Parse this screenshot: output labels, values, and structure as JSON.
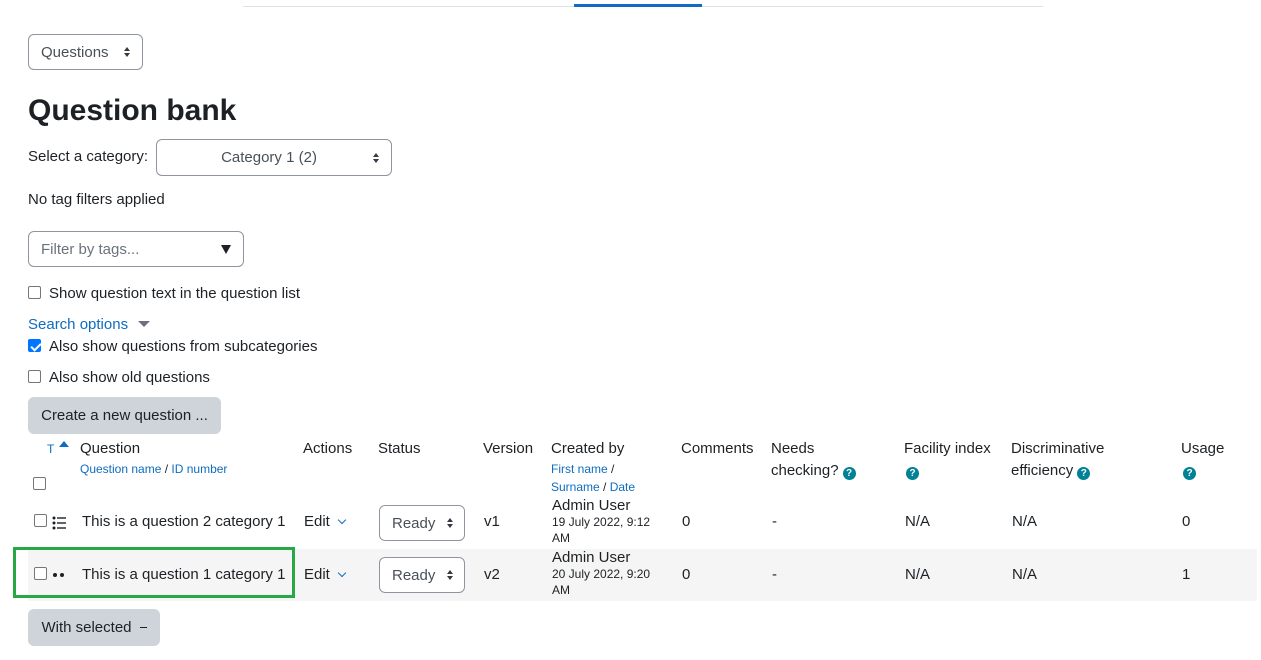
{
  "top_select": {
    "value": "Questions"
  },
  "page_title": "Question bank",
  "category": {
    "label": "Select a category:",
    "value": "Category 1 (2)"
  },
  "tags": {
    "status": "No tag filters applied",
    "placeholder": "Filter by tags..."
  },
  "options": {
    "show_text": "Show question text in the question list",
    "search_options": "Search options",
    "subcategories": "Also show questions from subcategories",
    "old_questions": "Also show old questions"
  },
  "create_button": "Create a new question ...",
  "table": {
    "sort_label": "T",
    "headers": {
      "question": "Question",
      "question_name": "Question name",
      "sep1": " / ",
      "id_number": "ID number",
      "actions": "Actions",
      "status": "Status",
      "version": "Version",
      "created_by": "Created by",
      "first_name": "First name",
      "sep2": " /",
      "surname": "Surname",
      "sep3": " / ",
      "date": "Date",
      "comments": "Comments",
      "needs1": "Needs",
      "needs2": "checking?",
      "facility": "Facility index",
      "disc1": "Discriminative",
      "disc2": "efficiency",
      "usage": "Usage",
      "help_icon": "?"
    },
    "rows": [
      {
        "question": "This is a question 2 category 1",
        "action": "Edit",
        "status": "Ready",
        "version": "v1",
        "creator": "Admin User",
        "date": "19 July 2022, 9:12 AM",
        "comments": "0",
        "needs": "-",
        "facility": "N/A",
        "disc": "N/A",
        "usage": "0"
      },
      {
        "question": "This is a question 1 category 1",
        "action": "Edit",
        "status": "Ready",
        "version": "v2",
        "creator": "Admin User",
        "date": "20 July 2022, 9:20 AM",
        "comments": "0",
        "needs": "-",
        "facility": "N/A",
        "disc": "N/A",
        "usage": "1"
      }
    ]
  },
  "with_selected": "With selected",
  "colors": {
    "link": "#0f6cbf",
    "highlight": "#28a745",
    "help": "#008196"
  }
}
